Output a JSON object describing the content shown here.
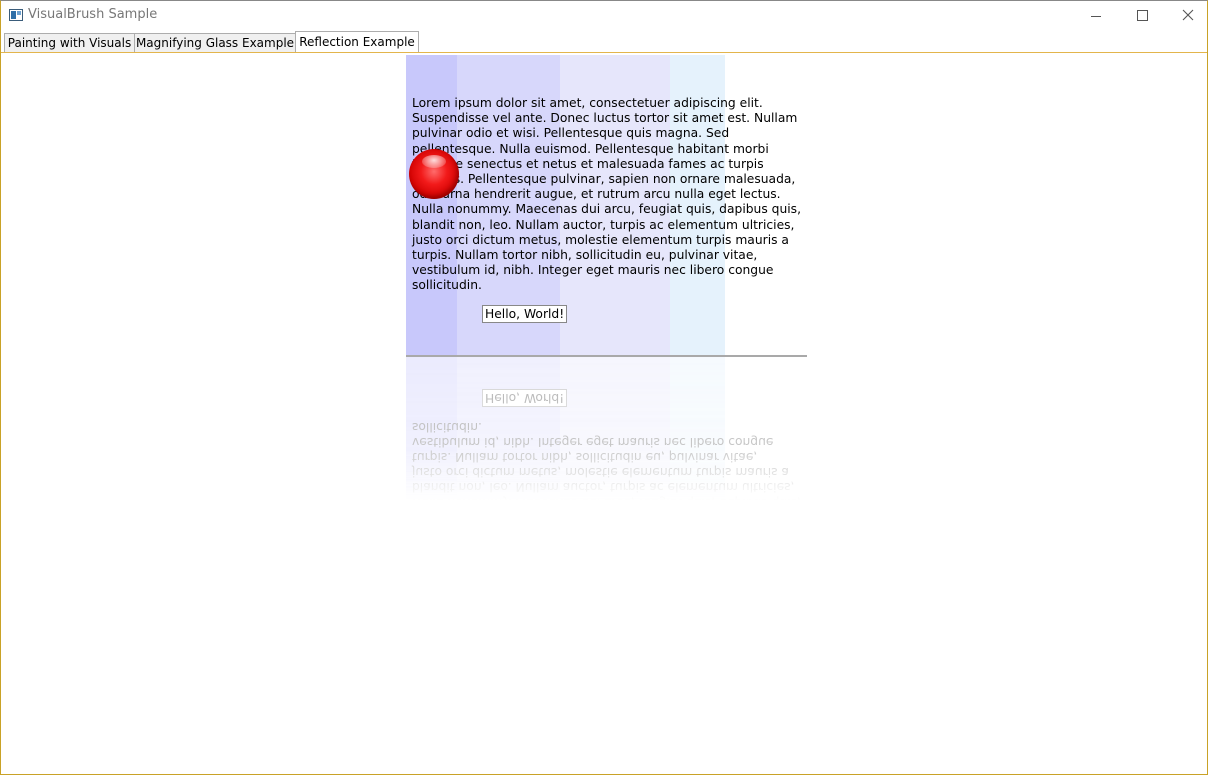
{
  "window": {
    "title": "VisualBrush Sample",
    "icon": "app-window-icon",
    "controls": [
      "minimize-icon",
      "maximize-icon",
      "close-icon"
    ]
  },
  "tabs": [
    {
      "label": "Painting with Visuals",
      "active": false
    },
    {
      "label": "Magnifying Glass Example",
      "active": false
    },
    {
      "label": "Reflection Example",
      "active": true
    }
  ],
  "content": {
    "lorem_text": "Lorem ipsum dolor sit amet, consectetuer adipiscing elit. Suspendisse vel ante. Donec luctus tortor sit amet est. Nullam pulvinar odio et wisi. Pellentesque quis magna. Sed pellentesque. Nulla euismod. Pellentesque habitant morbi tristique senectus et netus et malesuada fames ac turpis egestas. Pellentesque pulvinar, sapien non ornare malesuada, odio urna hendrerit augue, et rutrum arcu nulla eget lectus. Nulla nonummy. Maecenas dui arcu, feugiat quis, dapibus quis, blandit non, leo. Nullam auctor, turpis ac elementum ultricies, justo orci dictum metus, molestie elementum turpis mauris a turpis. Nullam tortor nibh, sollicitudin eu, pulvinar vitae, vestibulum id, nibh. Integer eget mauris nec libero congue sollicitudin.",
    "button_label": "Hello, World!",
    "ball_color": "#e00000",
    "band_colors": [
      "#c8c8fb",
      "#d7d7fb",
      "#e6e6fb",
      "#e5f2fc"
    ]
  }
}
